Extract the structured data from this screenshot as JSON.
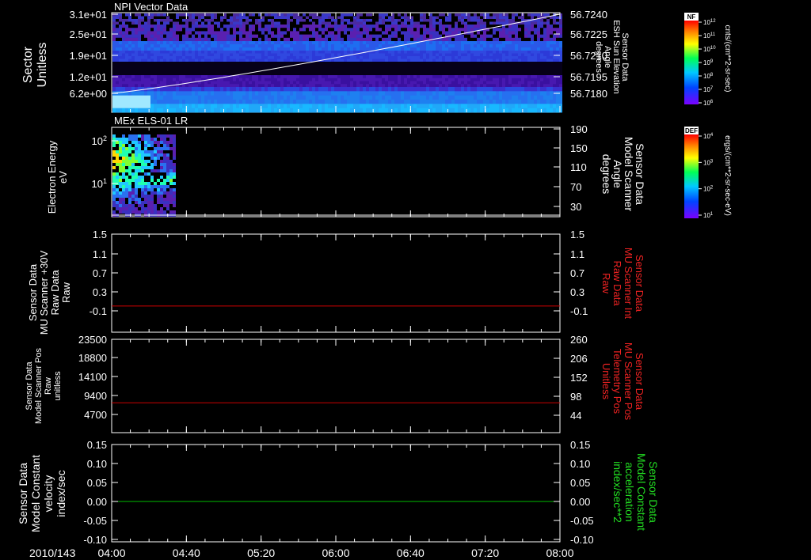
{
  "time_axis": {
    "date_label": "2010/143",
    "ticks": [
      "04:00",
      "04:40",
      "05:20",
      "06:00",
      "06:40",
      "07:20",
      "08:00"
    ]
  },
  "colors": {
    "axes": "#ffffff",
    "red_line": "#cc0000",
    "red_label": "#ee2222",
    "green_line": "#00bb00",
    "green_label": "#22dd22",
    "white_line": "#ffffff"
  },
  "chart_data": [
    {
      "type": "heatmap",
      "title": "NPI Vector Data",
      "ylabel": [
        "Sector",
        "Unitless"
      ],
      "yticks_left": [
        "3.1e+01",
        "2.5e+01",
        "1.9e+01",
        "1.2e+01",
        "6.2e+00"
      ],
      "yticks_right": [
        "56.7240",
        "56.7225",
        "56.7210",
        "56.7195",
        "56.7180"
      ],
      "ylabel_right": [
        "Sensor Data",
        "ESH Sun Elevation",
        "Angle",
        "degrees"
      ],
      "overlay_line": {
        "x": [
          "04:00",
          "08:00"
        ],
        "y": [
          56.718,
          56.724
        ]
      },
      "colorbar": {
        "label": "NF",
        "ticks": [
          "10^12",
          "10^11",
          "10^10",
          "10^9",
          "10^8",
          "10^7",
          "10^6"
        ],
        "unit": "cnts/(cm**2-sr-sec)"
      }
    },
    {
      "type": "heatmap",
      "title": "MEx ELS-01 LR",
      "ylabel": [
        "Electron Energy",
        "eV"
      ],
      "yticks_left": [
        "10^2",
        "10^1"
      ],
      "yticks_right": [
        "190",
        "150",
        "110",
        "70",
        "30"
      ],
      "ylabel_right": [
        "Sensor Data",
        "Model Scanner",
        "Angle",
        "degrees"
      ],
      "colorbar": {
        "label": "DEF",
        "ticks": [
          "10^4",
          "10^3",
          "10^2",
          "10^1"
        ],
        "unit": "ergs/(cm**2-sr-sec-eV)"
      }
    },
    {
      "type": "line",
      "ylabel": [
        "Sensor Data",
        "MU Scanner +30V",
        "Raw Data",
        "Raw"
      ],
      "yticks_left": [
        "1.5",
        "1.1",
        "0.7",
        "0.3",
        "-0.1"
      ],
      "yticks_right": [
        "1.5",
        "1.1",
        "0.7",
        "0.3",
        "-0.1"
      ],
      "ylabel_right": [
        "Sensor Data",
        "MU Scanner Int",
        "Raw Data",
        "Raw"
      ],
      "ylim": [
        -0.35,
        1.5
      ],
      "series": [
        {
          "x": [
            "04:00",
            "08:00"
          ],
          "y": [
            0.0,
            0.0
          ]
        }
      ]
    },
    {
      "type": "line",
      "ylabel": [
        "Sensor Data",
        "Model Scanner Pos",
        "Raw",
        "unitless"
      ],
      "yticks_left": [
        "23500",
        "18800",
        "14100",
        "9400",
        "4700"
      ],
      "yticks_right": [
        "260",
        "206",
        "152",
        "98",
        "44"
      ],
      "ylabel_right": [
        "Sensor Data",
        "MU Scanner Pos",
        "Telemetry Pos",
        "Unitless"
      ],
      "ylim": [
        0,
        23500
      ],
      "series": [
        {
          "x": [
            "04:00",
            "08:00"
          ],
          "y": [
            7600,
            7600
          ]
        }
      ]
    },
    {
      "type": "line",
      "ylabel": [
        "Sensor Data",
        "Model Constant",
        "velocity",
        "index/sec"
      ],
      "yticks_left": [
        "0.15",
        "0.10",
        "0.05",
        "0.00",
        "-0.05",
        "-0.10"
      ],
      "yticks_right": [
        "0.15",
        "0.10",
        "0.05",
        "0.00",
        "-0.05",
        "-0.10"
      ],
      "ylabel_right": [
        "Sensor Data",
        "Model Constant",
        "acceleration",
        "index/sec**2"
      ],
      "ylim": [
        -0.1,
        0.15
      ],
      "series": [
        {
          "x": [
            "04:00",
            "08:00"
          ],
          "y": [
            0.0,
            0.0
          ]
        }
      ]
    }
  ]
}
